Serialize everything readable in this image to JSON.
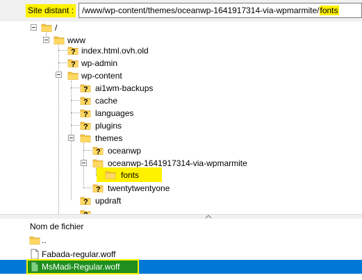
{
  "address_bar": {
    "label": "Site distant :",
    "path_prefix": "/www/wp-content/themes/oceanwp-1641917314-via-wpmarmite/",
    "path_highlight": "fonts"
  },
  "tree": {
    "root": "/",
    "www": "www",
    "index": "index.html.ovh.old",
    "wp_admin": "wp-admin",
    "wp_content": "wp-content",
    "ai1wm": "ai1wm-backups",
    "cache": "cache",
    "languages": "languages",
    "plugins": "plugins",
    "themes": "themes",
    "oceanwp": "oceanwp",
    "oceanwp_via": "oceanwp-1641917314-via-wpmarmite",
    "fonts": "fonts",
    "twentytwentyone": "twentytwentyone",
    "updraft": "updraft"
  },
  "file_list": {
    "column_header": "Nom de fichier",
    "parent": "..",
    "files": [
      "Fabada-regular.woff",
      "MsMadi-Regular.woff"
    ]
  },
  "colors": {
    "highlight": "#fff200",
    "selection": "#0078d7",
    "folder": "#f5c445"
  }
}
